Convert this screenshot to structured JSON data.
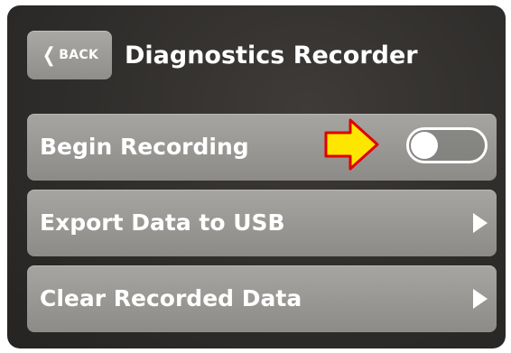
{
  "header": {
    "back_label": "BACK",
    "title": "Diagnostics Recorder"
  },
  "rows": [
    {
      "label": "Begin Recording",
      "control": "toggle",
      "toggle_on": false
    },
    {
      "label": "Export Data to USB",
      "control": "chevron-right-icon"
    },
    {
      "label": "Clear Recorded Data",
      "control": "chevron-right-icon"
    }
  ],
  "annotation": {
    "icon": "arrow-right-icon",
    "fill": "#ffe600",
    "stroke": "#e00000"
  },
  "colors": {
    "screen_bg": "#2f2d2b",
    "row_bg": "#9a9995",
    "text": "#ffffff"
  }
}
